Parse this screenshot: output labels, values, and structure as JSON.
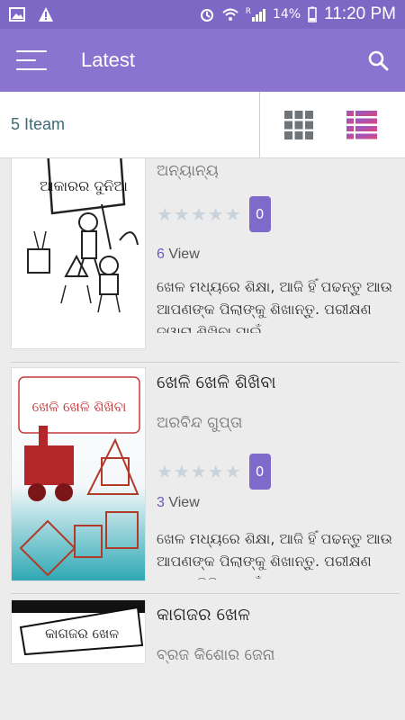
{
  "statusbar": {
    "battery": "14%",
    "time": "11:20 PM",
    "signal_label": "R"
  },
  "appbar": {
    "title": "Latest"
  },
  "toolbar": {
    "count_label": "5 Iteam"
  },
  "colors": {
    "primary": "#8a74cf",
    "statusbar": "#7e68c6",
    "badge": "#7e6bc9",
    "list_icon": "#c73d8a",
    "grid_icon": "#6f7478"
  },
  "books": [
    {
      "title": "",
      "author": "ଅନ୍ୟାନ୍ୟ",
      "rating_count": "0",
      "views_num": "6",
      "views_label": "View",
      "desc": "ଖେଳ ମଧ୍ୟରେ ଶିକ୍ଷା, ଆଜି ହିଁ ପଢନ୍ତୁ ଆଉ ଆପଣଙ୍କ ପିଲାଙ୍କୁ ଶିଖାନ୍ତୁ. ପରୀକ୍ଷଣ ଦ୍ୱାରା ଶିଖିବା ପାଇଁ",
      "cover_text": "ଆକାରର ଦୁନିଆ"
    },
    {
      "title": "ଖେଳି ଖେଳି ଶିଖିବା",
      "author": "ଅରବିନ୍ଦ ଗୁପ୍ତା",
      "rating_count": "0",
      "views_num": "3",
      "views_label": "View",
      "desc": "ଖେଳ ମଧ୍ୟରେ ଶିକ୍ଷା, ଆଜି ହିଁ ପଢନ୍ତୁ ଆଉ ଆପଣଙ୍କ ପିଲାଙ୍କୁ ଶିଖାନ୍ତୁ. ପରୀକ୍ଷଣ ଦ୍ୱାରା ଶିଖିବା ପାଇଁ",
      "cover_text": "ଖେଳି ଖେଳି ଶିଖିବା"
    },
    {
      "title": "କାଗଜର ଖେଳ",
      "author": "ବ୍ରଜ କିଶୋର ଜେନା",
      "cover_text": "କାଗଜର ଖେଳ"
    }
  ]
}
